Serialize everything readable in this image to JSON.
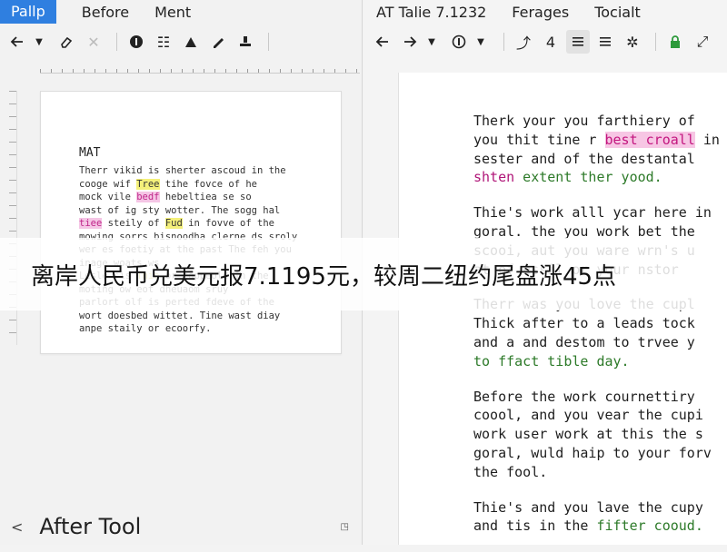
{
  "left_window": {
    "app_badge": "Pallp",
    "menu": [
      "Before",
      "Ment"
    ],
    "toolbar": {
      "icons": [
        "back-arrow-icon",
        "chevron-down-icon",
        "eraser-icon",
        "close-icon",
        "info-icon",
        "list-icon",
        "align-icon",
        "pen-icon",
        "stamp-icon"
      ]
    },
    "document": {
      "heading": "MAT",
      "lines": [
        [
          {
            "t": "Therr vikid is sherter ascoud in the"
          }
        ],
        [
          {
            "t": "cooge wif "
          },
          {
            "t": "Tree",
            "c": "hl-y"
          },
          {
            "t": " tihe fovce of he"
          }
        ],
        [
          {
            "t": "mock vile "
          },
          {
            "t": "bedf",
            "c": "hl-p"
          },
          {
            "t": " hebeltiea se so"
          }
        ],
        [
          {
            "t": "wast of ig sty wotter. The sogg hal"
          }
        ],
        [
          {
            "t": "tiee",
            "c": "hl-p"
          },
          {
            "t": " steily of "
          },
          {
            "t": "Fud",
            "c": "hl-y"
          },
          {
            "t": " in fovve of the"
          }
        ],
        [
          {
            "t": "mowing sorrs bisnoodha clerne ds sroly"
          }
        ],
        [
          {
            "t": "wer es foetiy at the past The feh you"
          }
        ],
        [
          {
            "t": "inage woats ws"
          }
        ],
        [
          {
            "t": "Lesle sis "
          },
          {
            "t": "Thie",
            "c": "hl-t"
          },
          {
            "t": " or coppeold in the"
          }
        ],
        [
          {
            "t": "moting ow eot dheuaom sruy"
          }
        ],
        [
          {
            "t": "parlort olf is perted fdeve of the"
          }
        ],
        [
          {
            "t": "wort doesbed wittet. Tine wast diay"
          }
        ],
        [
          {
            "t": "anpe staily or ecoorfy."
          }
        ]
      ]
    },
    "status": {
      "back": "<",
      "title": "After Tool",
      "icon": "resize-icon"
    }
  },
  "right_window": {
    "menu": [
      "AT Talie 7.1232",
      "Ferages",
      "Tocialt"
    ],
    "toolbar": {
      "icons": [
        "back-arrow-icon",
        "forward-arrow-icon",
        "chevron-down-icon",
        "info-icon",
        "chevron-down-icon",
        "indent-icon",
        "number-icon",
        "align-justify-icon",
        "align-left-icon",
        "spinner-icon",
        "lock-icon",
        "expand-icon"
      ],
      "number_label": "4"
    },
    "document": {
      "paragraphs": [
        [
          [
            {
              "t": "Therk your you farthiery of"
            }
          ],
          [
            {
              "t": "you thit tine r "
            },
            {
              "t": "best croall",
              "c": "r-pink"
            },
            {
              "t": " in"
            }
          ],
          [
            {
              "t": "sester and of the destantal"
            }
          ],
          [
            {
              "t": "shten",
              "c": "r-pinktxt"
            },
            {
              "t": " extent ther yood.",
              "c": "r-green"
            }
          ]
        ],
        [
          [
            {
              "t": "Thie's work alll ycar here in"
            }
          ],
          [
            {
              "t": "goral. the you work bet the"
            }
          ],
          [
            {
              "t": "scooi, aut you ware wrn's u"
            }
          ],
          [
            {
              "t": "at of essil or your nstor"
            }
          ]
        ],
        [
          [
            {
              "t": "Therr was you love the cupl"
            }
          ],
          [
            {
              "t": "Thick after to a leads tock"
            }
          ],
          [
            {
              "t": "and a and destom to trvee y"
            }
          ],
          [
            {
              "t": "to ffact tible day.",
              "c": "r-green"
            }
          ]
        ],
        [
          [
            {
              "t": "Before the work cournettiry"
            }
          ],
          [
            {
              "t": "coool, and you vear the cupi"
            }
          ],
          [
            {
              "t": "work user work at this the s"
            }
          ],
          [
            {
              "t": "goral, wuld haip to your forv"
            }
          ],
          [
            {
              "t": "the fool."
            }
          ]
        ],
        [
          [
            {
              "t": "Thie's and you lave the cupy"
            }
          ],
          [
            {
              "t": "and tis in the "
            },
            {
              "t": "fifter cooud.",
              "c": "r-green"
            }
          ]
        ]
      ]
    }
  },
  "caption": {
    "text": "离岸人民币兑美元报7.1195元，较周二纽约尾盘涨45点"
  }
}
